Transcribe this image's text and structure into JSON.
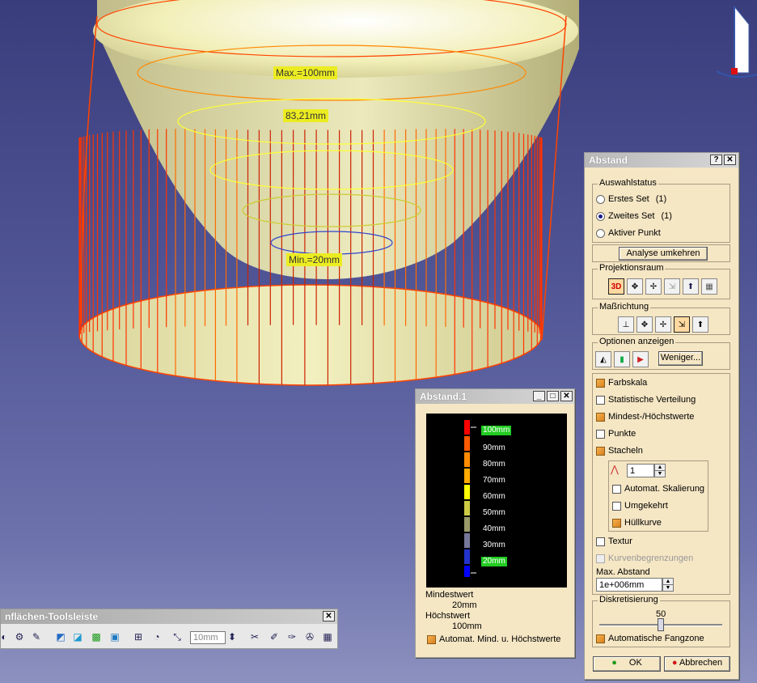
{
  "viewport": {
    "label_max": "Max.=100mm",
    "label_mid": "83,21mm",
    "label_min": "Min.=20mm",
    "colors": {
      "background_top": "#3a3d7c",
      "surface": "#f4f1b8",
      "spikes": "#ff3300",
      "hull": "#ffff33"
    }
  },
  "dialog": {
    "title": "Abstand",
    "help": "?",
    "close": "✕",
    "selection": {
      "legend": "Auswahlstatus",
      "first_set": "Erstes Set",
      "first_count": "(1)",
      "second_set": "Zweites Set",
      "second_count": "(1)",
      "active_point": "Aktiver Punkt",
      "selected": "second_set"
    },
    "invert_button": "Analyse umkehren",
    "projection": {
      "legend": "Projektionsraum",
      "icon_3d": "3D"
    },
    "measure_direction": {
      "legend": "Maßrichtung"
    },
    "display_options": {
      "legend": "Optionen anzeigen",
      "less_button": "Weniger..."
    },
    "options": {
      "color_scale": "Farbskala",
      "statistics": "Statistische Verteilung",
      "min_max": "Mindest-/Höchstwerte",
      "points": "Punkte",
      "spikes": "Stacheln",
      "spike_value": "1",
      "auto_scale": "Automat. Skalierung",
      "inverted": "Umgekehrt",
      "envelope": "Hüllkurve",
      "texture": "Textur",
      "curve_limits": "Kurvenbegrenzungen",
      "max_distance_label": "Max. Abstand",
      "max_distance_value": "1e+006mm"
    },
    "discretization": {
      "legend": "Diskretisierung",
      "value": "50",
      "level": 0.5
    },
    "auto_snap": "Automatische Fangzone",
    "ok_button": "OK",
    "cancel_button": "Abbrechen"
  },
  "scale_window": {
    "title": "Abstand.1",
    "labels": [
      "100mm",
      "90mm",
      "80mm",
      "70mm",
      "60mm",
      "50mm",
      "40mm",
      "30mm",
      "20mm"
    ],
    "min_label": "Mindestwert",
    "min_value": "20mm",
    "max_label": "Höchstwert",
    "max_value": "100mm",
    "auto_minmax": "Automat. Mind. u. Höchstwerte"
  },
  "toolbar": {
    "title": "nflächen-Toolsleiste",
    "zoom_value": "10mm"
  }
}
